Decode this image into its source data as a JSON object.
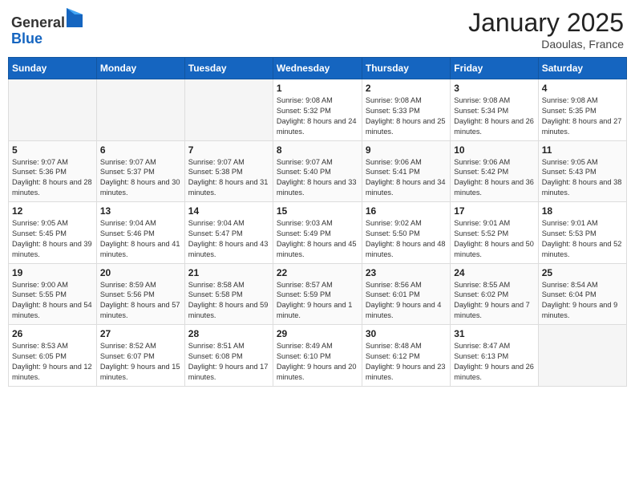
{
  "header": {
    "logo_general": "General",
    "logo_blue": "Blue",
    "month": "January 2025",
    "location": "Daoulas, France"
  },
  "weekdays": [
    "Sunday",
    "Monday",
    "Tuesday",
    "Wednesday",
    "Thursday",
    "Friday",
    "Saturday"
  ],
  "weeks": [
    [
      {
        "day": "",
        "empty": true
      },
      {
        "day": "",
        "empty": true
      },
      {
        "day": "",
        "empty": true
      },
      {
        "day": "1",
        "sunrise": "9:08 AM",
        "sunset": "5:32 PM",
        "daylight": "8 hours and 24 minutes."
      },
      {
        "day": "2",
        "sunrise": "9:08 AM",
        "sunset": "5:33 PM",
        "daylight": "8 hours and 25 minutes."
      },
      {
        "day": "3",
        "sunrise": "9:08 AM",
        "sunset": "5:34 PM",
        "daylight": "8 hours and 26 minutes."
      },
      {
        "day": "4",
        "sunrise": "9:08 AM",
        "sunset": "5:35 PM",
        "daylight": "8 hours and 27 minutes."
      }
    ],
    [
      {
        "day": "5",
        "sunrise": "9:07 AM",
        "sunset": "5:36 PM",
        "daylight": "8 hours and 28 minutes."
      },
      {
        "day": "6",
        "sunrise": "9:07 AM",
        "sunset": "5:37 PM",
        "daylight": "8 hours and 30 minutes."
      },
      {
        "day": "7",
        "sunrise": "9:07 AM",
        "sunset": "5:38 PM",
        "daylight": "8 hours and 31 minutes."
      },
      {
        "day": "8",
        "sunrise": "9:07 AM",
        "sunset": "5:40 PM",
        "daylight": "8 hours and 33 minutes."
      },
      {
        "day": "9",
        "sunrise": "9:06 AM",
        "sunset": "5:41 PM",
        "daylight": "8 hours and 34 minutes."
      },
      {
        "day": "10",
        "sunrise": "9:06 AM",
        "sunset": "5:42 PM",
        "daylight": "8 hours and 36 minutes."
      },
      {
        "day": "11",
        "sunrise": "9:05 AM",
        "sunset": "5:43 PM",
        "daylight": "8 hours and 38 minutes."
      }
    ],
    [
      {
        "day": "12",
        "sunrise": "9:05 AM",
        "sunset": "5:45 PM",
        "daylight": "8 hours and 39 minutes."
      },
      {
        "day": "13",
        "sunrise": "9:04 AM",
        "sunset": "5:46 PM",
        "daylight": "8 hours and 41 minutes."
      },
      {
        "day": "14",
        "sunrise": "9:04 AM",
        "sunset": "5:47 PM",
        "daylight": "8 hours and 43 minutes."
      },
      {
        "day": "15",
        "sunrise": "9:03 AM",
        "sunset": "5:49 PM",
        "daylight": "8 hours and 45 minutes."
      },
      {
        "day": "16",
        "sunrise": "9:02 AM",
        "sunset": "5:50 PM",
        "daylight": "8 hours and 48 minutes."
      },
      {
        "day": "17",
        "sunrise": "9:01 AM",
        "sunset": "5:52 PM",
        "daylight": "8 hours and 50 minutes."
      },
      {
        "day": "18",
        "sunrise": "9:01 AM",
        "sunset": "5:53 PM",
        "daylight": "8 hours and 52 minutes."
      }
    ],
    [
      {
        "day": "19",
        "sunrise": "9:00 AM",
        "sunset": "5:55 PM",
        "daylight": "8 hours and 54 minutes."
      },
      {
        "day": "20",
        "sunrise": "8:59 AM",
        "sunset": "5:56 PM",
        "daylight": "8 hours and 57 minutes."
      },
      {
        "day": "21",
        "sunrise": "8:58 AM",
        "sunset": "5:58 PM",
        "daylight": "8 hours and 59 minutes."
      },
      {
        "day": "22",
        "sunrise": "8:57 AM",
        "sunset": "5:59 PM",
        "daylight": "9 hours and 1 minute."
      },
      {
        "day": "23",
        "sunrise": "8:56 AM",
        "sunset": "6:01 PM",
        "daylight": "9 hours and 4 minutes."
      },
      {
        "day": "24",
        "sunrise": "8:55 AM",
        "sunset": "6:02 PM",
        "daylight": "9 hours and 7 minutes."
      },
      {
        "day": "25",
        "sunrise": "8:54 AM",
        "sunset": "6:04 PM",
        "daylight": "9 hours and 9 minutes."
      }
    ],
    [
      {
        "day": "26",
        "sunrise": "8:53 AM",
        "sunset": "6:05 PM",
        "daylight": "9 hours and 12 minutes."
      },
      {
        "day": "27",
        "sunrise": "8:52 AM",
        "sunset": "6:07 PM",
        "daylight": "9 hours and 15 minutes."
      },
      {
        "day": "28",
        "sunrise": "8:51 AM",
        "sunset": "6:08 PM",
        "daylight": "9 hours and 17 minutes."
      },
      {
        "day": "29",
        "sunrise": "8:49 AM",
        "sunset": "6:10 PM",
        "daylight": "9 hours and 20 minutes."
      },
      {
        "day": "30",
        "sunrise": "8:48 AM",
        "sunset": "6:12 PM",
        "daylight": "9 hours and 23 minutes."
      },
      {
        "day": "31",
        "sunrise": "8:47 AM",
        "sunset": "6:13 PM",
        "daylight": "9 hours and 26 minutes."
      },
      {
        "day": "",
        "empty": true
      }
    ]
  ],
  "labels": {
    "sunrise": "Sunrise:",
    "sunset": "Sunset:",
    "daylight": "Daylight:"
  }
}
